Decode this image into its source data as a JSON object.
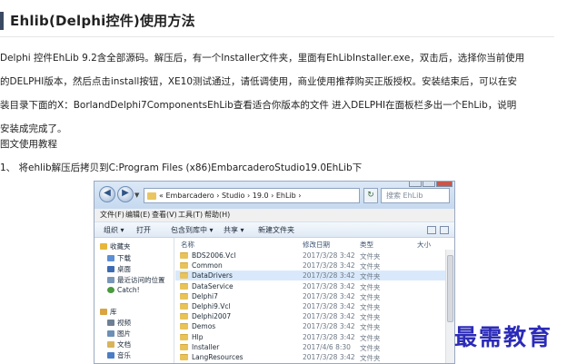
{
  "article": {
    "title": "Ehlib(Delphi控件)使用方法",
    "paragraph_lines": [
      "Delphi 控件EhLib 9.2含全部源码。解压后，有一个Installer文件夹，里面有EhLibInstaller.exe，双击后，选择你当前使用",
      "的DELPHI版本，然后点击install按钮，XE10测试通过，请低调使用，商业使用推荐购买正版授权。安装结束后，可以在安",
      "装目录下面的X：BorlandDelphi7ComponentsEhLib查看适合你版本的文件 进入DELPHI在面板栏多出一个EhLib，说明",
      "安装成完成了。"
    ],
    "section_label": "图文使用教程",
    "step_1": "1、 将ehlib解压后拷贝到C:Program Files (x86)EmbarcaderoStudio19.0EhLib下"
  },
  "explorer": {
    "address_path": "«  Embarcadero › Studio › 19.0 › EhLib ›",
    "search_placeholder": "搜索 EhLib",
    "menu": [
      "文件(F)",
      "编辑(E)",
      "查看(V)",
      "工具(T)",
      "帮助(H)"
    ],
    "toolbar": [
      "组织 ▾",
      "打开",
      "包含到库中 ▾",
      "共享 ▾",
      "新建文件夹"
    ],
    "nav_items": [
      {
        "label": "收藏夹",
        "icon": "star-icon",
        "color": "#e7b73c"
      },
      {
        "label": "下载",
        "icon": "download-folder-icon",
        "color": "#5d8fd3"
      },
      {
        "label": "桌面",
        "icon": "desktop-icon",
        "color": "#3d6bb3"
      },
      {
        "label": "最近访问的位置",
        "icon": "recent-places-icon",
        "color": "#7a96b8"
      },
      {
        "label": "Catch!",
        "icon": "catch-app-icon",
        "color": "#4a9a3e"
      },
      {
        "label": "库",
        "icon": "library-icon",
        "color": "#d9a441"
      },
      {
        "label": "视频",
        "icon": "video-icon",
        "color": "#6e7f93"
      },
      {
        "label": "图片",
        "icon": "pictures-icon",
        "color": "#6c8fb6"
      },
      {
        "label": "文档",
        "icon": "documents-icon",
        "color": "#d8b45b"
      },
      {
        "label": "音乐",
        "icon": "music-icon",
        "color": "#4c7dc4"
      }
    ],
    "columns": {
      "name": "名称",
      "date": "修改日期",
      "type": "类型",
      "size": "大小"
    },
    "files": [
      {
        "name": "BDS2006.Vcl",
        "date": "2017/3/28 3:42",
        "type": "文件夹"
      },
      {
        "name": "Common",
        "date": "2017/3/28 3:42",
        "type": "文件夹"
      },
      {
        "name": "DataDrivers",
        "date": "2017/3/28 3:42",
        "type": "文件夹",
        "selected": true
      },
      {
        "name": "DataService",
        "date": "2017/3/28 3:42",
        "type": "文件夹"
      },
      {
        "name": "Delphi7",
        "date": "2017/3/28 3:42",
        "type": "文件夹"
      },
      {
        "name": "Delphi9.Vcl",
        "date": "2017/3/28 3:42",
        "type": "文件夹"
      },
      {
        "name": "Delphi2007",
        "date": "2017/3/28 3:42",
        "type": "文件夹"
      },
      {
        "name": "Demos",
        "date": "2017/3/28 3:42",
        "type": "文件夹"
      },
      {
        "name": "Hlp",
        "date": "2017/3/28 3:42",
        "type": "文件夹"
      },
      {
        "name": "Installer",
        "date": "2017/4/6 8:30",
        "type": "文件夹"
      },
      {
        "name": "LangResources",
        "date": "2017/3/28 3:42",
        "type": "文件夹"
      }
    ]
  },
  "watermark": "最需教育"
}
